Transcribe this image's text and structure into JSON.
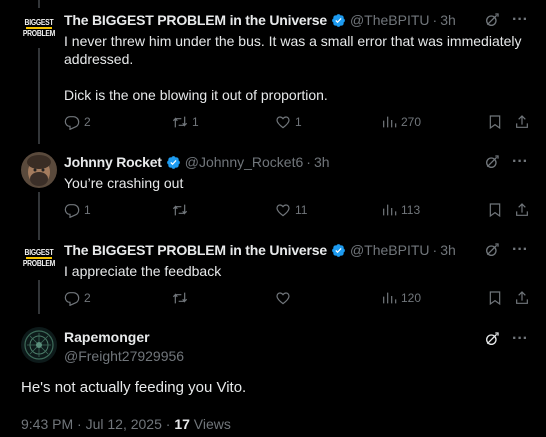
{
  "replies": [
    {
      "author": "The BIGGEST PROBLEM in the Universe",
      "handle": "@TheBPITU",
      "time": "3h",
      "avatar_text": [
        "BIGGEST",
        "PROBLEM"
      ],
      "text_lines": [
        "I never threw him under the bus. It was a small error that was immediately",
        "addressed.",
        "",
        "Dick is the one blowing it out of proportion."
      ],
      "stats": {
        "replies": "2",
        "reposts": "1",
        "likes": "1",
        "views": "270"
      }
    },
    {
      "author": "Johnny Rocket",
      "handle": "@Johnny_Rocket6",
      "time": "3h",
      "text_lines": [
        "You’re crashing out"
      ],
      "stats": {
        "replies": "1",
        "reposts": "",
        "likes": "11",
        "views": "113"
      }
    },
    {
      "author": "The BIGGEST PROBLEM in the Universe",
      "handle": "@TheBPITU",
      "time": "3h",
      "avatar_text": [
        "BIGGEST",
        "PROBLEM"
      ],
      "text_lines": [
        "I appreciate the feedback"
      ],
      "stats": {
        "replies": "2",
        "reposts": "",
        "likes": "",
        "views": "120"
      }
    }
  ],
  "main_post": {
    "author": "Rapemonger",
    "handle": "@Freight27929956",
    "text": "He's not actually feeding you Vito.",
    "timestamp": "9:43 PM · Jul 12, 2025 · ",
    "views_count": "17",
    "views_label": " Views"
  },
  "dot": "·",
  "icons": {
    "reply": "reply-icon",
    "repost": "repost-icon",
    "like": "like-icon",
    "views": "views-icon",
    "bookmark": "bookmark-icon",
    "share": "share-icon",
    "grok": "grok-icon",
    "more": "more-icon",
    "verified": "verified-icon"
  },
  "colors": {
    "background": "#000000",
    "text": "#e7e9ea",
    "muted": "#71767b",
    "verified": "#1d9bf0",
    "thread_line": "#333639",
    "logo_accent": "#f5c400"
  }
}
